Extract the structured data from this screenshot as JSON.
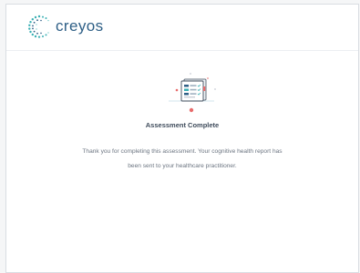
{
  "header": {
    "logo_text": "creyos"
  },
  "main": {
    "title": "Assessment Complete",
    "message_line1": "Thank you for completing this assessment. Your cognitive health report has",
    "message_line2": "been sent to your healthcare practitioner."
  },
  "icons": {
    "logo": "creyos-dots-logo-icon",
    "illustration": "clipboard-checklist-icon"
  },
  "colors": {
    "brand_text": "#2e5f86",
    "brand_teal": "#3ab0b4",
    "accent_red": "#e86b6b",
    "title": "#3e4b5b",
    "body_text": "#6b7480"
  }
}
